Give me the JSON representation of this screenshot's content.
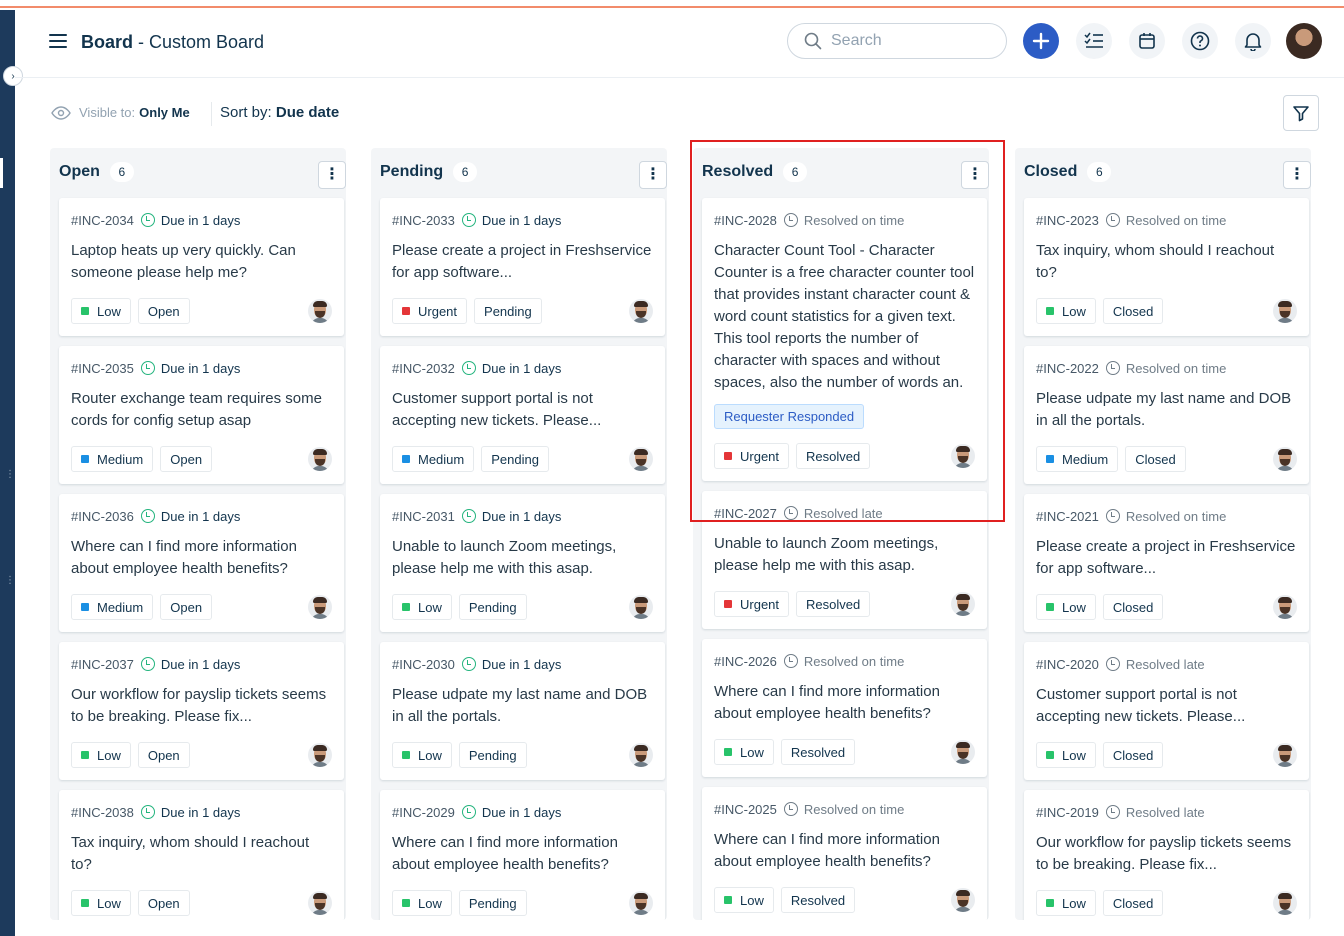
{
  "header": {
    "title_bold": "Board",
    "title_sep": " - ",
    "title_rest": "Custom Board",
    "search_placeholder": "Search"
  },
  "subbar": {
    "visible_label": "Visible to:",
    "visible_value": "Only Me",
    "sort_label": "Sort by:",
    "sort_value": "Due date"
  },
  "colors": {
    "priority_low": "#28c36a",
    "priority_medium": "#1a8fe3",
    "priority_urgent": "#e43538",
    "accent": "#2c5cc5",
    "highlight": "#e02020"
  },
  "columns": [
    {
      "title": "Open",
      "count": "6",
      "cards": [
        {
          "id": "#INC-2034",
          "due": "Due in 1 days",
          "subject": "Laptop heats up very quickly. Can someone please help me?",
          "priority": "Low",
          "status": "Open"
        },
        {
          "id": "#INC-2035",
          "due": "Due in 1 days",
          "subject": "Router exchange team requires some cords for config setup asap",
          "priority": "Medium",
          "status": "Open"
        },
        {
          "id": "#INC-2036",
          "due": "Due in 1 days",
          "subject": "Where can I find more information about employee health benefits?",
          "priority": "Medium",
          "status": "Open"
        },
        {
          "id": "#INC-2037",
          "due": "Due in 1 days",
          "subject": "Our workflow for payslip tickets seems to be breaking. Please fix...",
          "priority": "Low",
          "status": "Open"
        },
        {
          "id": "#INC-2038",
          "due": "Due in 1 days",
          "subject": "Tax inquiry, whom should I reachout to?",
          "priority": "Low",
          "status": "Open"
        }
      ]
    },
    {
      "title": "Pending",
      "count": "6",
      "cards": [
        {
          "id": "#INC-2033",
          "due": "Due in 1 days",
          "subject": "Please create a project in Freshservice for app software...",
          "priority": "Urgent",
          "status": "Pending"
        },
        {
          "id": "#INC-2032",
          "due": "Due in 1 days",
          "subject": "Customer support portal is not accepting new tickets. Please...",
          "priority": "Medium",
          "status": "Pending"
        },
        {
          "id": "#INC-2031",
          "due": "Due in 1 days",
          "subject": "Unable to launch Zoom meetings, please help me with this asap.",
          "priority": "Low",
          "status": "Pending"
        },
        {
          "id": "#INC-2030",
          "due": "Due in 1 days",
          "subject": "Please udpate my last name and DOB in all the portals.",
          "priority": "Low",
          "status": "Pending"
        },
        {
          "id": "#INC-2029",
          "due": "Due in 1 days",
          "subject": "Where can I find more information about employee health benefits?",
          "priority": "Low",
          "status": "Pending"
        }
      ]
    },
    {
      "title": "Resolved",
      "count": "6",
      "cards": [
        {
          "id": "#INC-2028",
          "due": "Resolved on time",
          "subject": "Character Count Tool - Character Counter is a free character counter tool that provides instant character count & word count statistics for a given text. This tool reports the number of character with spaces and without spaces, also the number of words an.",
          "tag": "Requester Responded",
          "priority": "Urgent",
          "status": "Resolved"
        },
        {
          "id": "#INC-2027",
          "due": "Resolved late",
          "subject": "Unable to launch Zoom meetings, please help me with this asap.",
          "priority": "Urgent",
          "status": "Resolved"
        },
        {
          "id": "#INC-2026",
          "due": "Resolved on time",
          "subject": "Where can I find more information about employee health benefits?",
          "priority": "Low",
          "status": "Resolved"
        },
        {
          "id": "#INC-2025",
          "due": "Resolved on time",
          "subject": "Where can I find more information about employee health benefits?",
          "priority": "Low",
          "status": "Resolved"
        }
      ]
    },
    {
      "title": "Closed",
      "count": "6",
      "cards": [
        {
          "id": "#INC-2023",
          "due": "Resolved on time",
          "subject": "Tax inquiry, whom should I reachout to?",
          "priority": "Low",
          "status": "Closed"
        },
        {
          "id": "#INC-2022",
          "due": "Resolved on time",
          "subject": "Please udpate my last name and DOB in all the portals.",
          "priority": "Medium",
          "status": "Closed"
        },
        {
          "id": "#INC-2021",
          "due": "Resolved on time",
          "subject": "Please create a project in Freshservice for app software...",
          "priority": "Low",
          "status": "Closed"
        },
        {
          "id": "#INC-2020",
          "due": "Resolved late",
          "subject": "Customer support portal is not accepting new tickets. Please...",
          "priority": "Low",
          "status": "Closed"
        },
        {
          "id": "#INC-2019",
          "due": "Resolved late",
          "subject": "Our workflow for payslip tickets seems to be breaking. Please fix...",
          "priority": "Low",
          "status": "Closed"
        }
      ]
    }
  ]
}
